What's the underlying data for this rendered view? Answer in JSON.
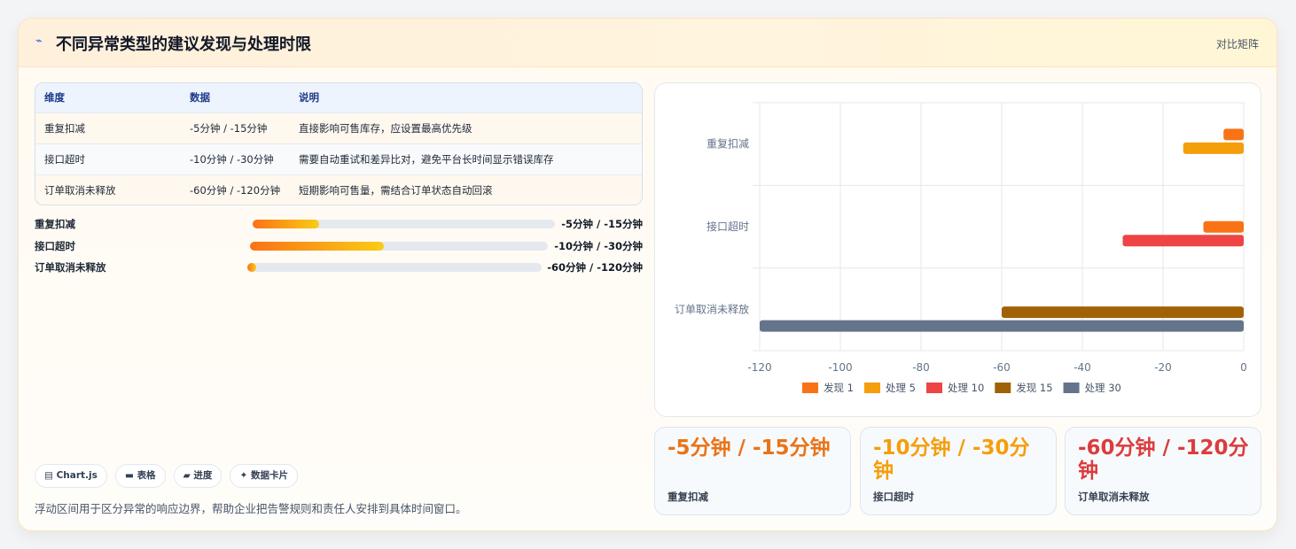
{
  "header": {
    "icon": "bolt-icon",
    "title": "不同异常类型的建议发现与处理时限",
    "tag": "对比矩阵"
  },
  "table": {
    "headers": [
      "维度",
      "数据",
      "说明"
    ],
    "rows": [
      [
        "重复扣减",
        "-5分钟 / -15分钟",
        "直接影响可售库存，应设置最高优先级"
      ],
      [
        "接口超时",
        "-10分钟 / -30分钟",
        "需要自动重试和差异比对，避免平台长时间显示错误库存"
      ],
      [
        "订单取消未释放",
        "-60分钟 / -120分钟",
        "短期影响可售量，需结合订单状态自动回滚"
      ]
    ]
  },
  "progress": [
    {
      "label": "重复扣减",
      "value": "-5分钟 / -15分钟",
      "fill": 0.22
    },
    {
      "label": "接口超时",
      "value": "-10分钟 / -30分钟",
      "fill": 0.45
    },
    {
      "label": "订单取消未释放",
      "value": "-60分钟 / -120分钟",
      "fill": 0.03
    }
  ],
  "chips": [
    {
      "icon": "chart-icon",
      "glyph": "▤",
      "label": "Chart.js"
    },
    {
      "icon": "table-icon",
      "glyph": "▬",
      "label": "表格"
    },
    {
      "icon": "progress-icon",
      "glyph": "▰",
      "label": "进度"
    },
    {
      "icon": "sparkle-icon",
      "glyph": "✦",
      "label": "数据卡片"
    }
  ],
  "footnote": "浮动区间用于区分异常的响应边界，帮助企业把告警规则和责任人安排到具体时间窗口。",
  "kpis": [
    {
      "value": "-5分钟 / -15分钟",
      "label": "重复扣减",
      "color": "#ea7317"
    },
    {
      "value": "-10分钟 / -30分钟",
      "label": "接口超时",
      "color": "#f59e0b"
    },
    {
      "value": "-60分钟 / -120分钟",
      "label": "订单取消未释放",
      "color": "#dc3c3c"
    }
  ],
  "chart_data": {
    "type": "bar",
    "orientation": "horizontal",
    "categories": [
      "重复扣减",
      "接口超时",
      "订单取消未释放"
    ],
    "series": [
      {
        "name": "发现 1",
        "color": "#f97316",
        "values": [
          -5,
          null,
          null
        ]
      },
      {
        "name": "处理 5",
        "color": "#f59e0b",
        "values": [
          -15,
          null,
          null
        ]
      },
      {
        "name": "处理 10",
        "color": "#ef4444",
        "values": [
          null,
          -30,
          null
        ]
      },
      {
        "name": "发现 15",
        "color": "#a16207",
        "values": [
          null,
          null,
          -60
        ]
      },
      {
        "name": "处理 30",
        "color": "#64748b",
        "values": [
          null,
          null,
          -120
        ]
      }
    ],
    "extra_bars": [
      {
        "category": "接口超时",
        "value": -10,
        "color": "#f97316"
      }
    ],
    "xlim": [
      -120,
      0
    ],
    "xticks": [
      -120,
      -100,
      -80,
      -60,
      -40,
      -20,
      0
    ],
    "grid": true,
    "legend": "bottom"
  }
}
